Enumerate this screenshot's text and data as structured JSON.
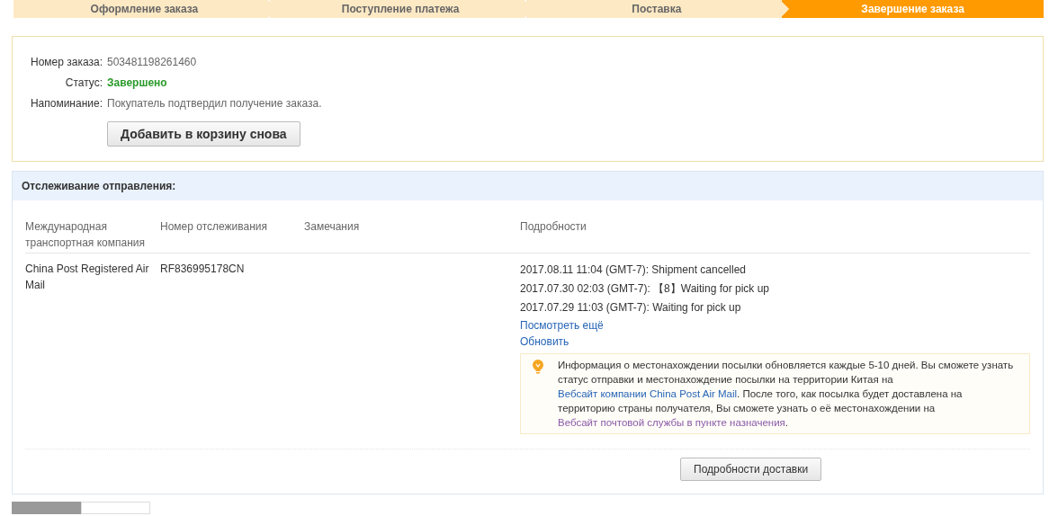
{
  "steps": [
    {
      "label": "Оформление заказа",
      "selected": false
    },
    {
      "label": "Поступление платежа",
      "selected": false
    },
    {
      "label": "Поставка",
      "selected": false
    },
    {
      "label": "Завершение заказа",
      "selected": true
    }
  ],
  "order": {
    "fields": [
      {
        "label": "Номер заказа:",
        "value": "503481198261460",
        "kind": "plain"
      },
      {
        "label": "Статус:",
        "value": "Завершено",
        "kind": "status"
      },
      {
        "label": "Напоминание:",
        "value": "Покупатель подтвердил получение заказа.",
        "kind": "plain"
      }
    ],
    "button": "Добавить в корзину снова"
  },
  "tracking": {
    "title": "Отслеживание отправления:",
    "columns": [
      "Международная транспортная компания",
      "Номер отслеживания",
      "Замечания",
      "Подробности"
    ],
    "row": {
      "carrier": "China Post Registered Air Mail",
      "tracking_number": "RF836995178CN",
      "events": [
        "2017.08.11 11:04 (GMT-7): Shipment cancelled",
        "2017.07.30 02:03 (GMT-7): 【8】Waiting for pick up",
        "2017.07.29 11:03 (GMT-7): Waiting for pick up"
      ],
      "links": [
        "Посмотреть ещё",
        "Обновить"
      ],
      "notice": [
        {
          "kind": "text",
          "text": "Информация о местонахождении посылки обновляется каждые 5-10 дней. Вы сможете узнать статус отправки и местонахождение посылки на территории Китая на "
        },
        {
          "kind": "link",
          "text": "Вебсайт компании China Post Air Mail",
          "visited": false
        },
        {
          "kind": "text",
          "text": ". После того, как посылка будет доставлена на территорию страны получателя, Вы сможете узнать о её местонахождении на "
        },
        {
          "kind": "link",
          "text": "Вебсайт почтовой службы в пункте назначения",
          "visited": true
        },
        {
          "kind": "text",
          "text": "."
        }
      ]
    },
    "button": "Подробности доставки"
  },
  "bottom_tabs": [
    {
      "selected": true
    },
    {
      "selected": false
    }
  ]
}
